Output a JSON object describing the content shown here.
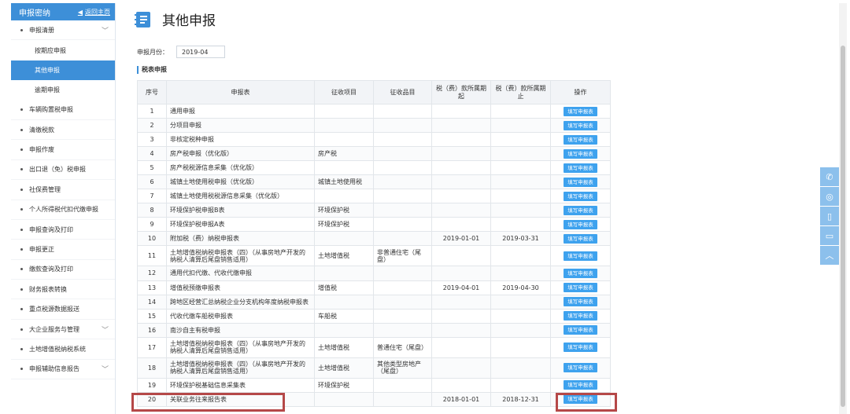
{
  "sidebar": {
    "header_title": "申报密纳",
    "back_label": "返回主页",
    "groups": [
      {
        "label": "申报清册",
        "expandable": true,
        "subs": [
          {
            "label": "按期应申报",
            "active": false
          },
          {
            "label": "其他申报",
            "active": true
          },
          {
            "label": "逾期申报",
            "active": false
          }
        ]
      },
      {
        "label": "车辆购置税申报",
        "expandable": false
      },
      {
        "label": "清缴税款",
        "expandable": false
      },
      {
        "label": "申报作废",
        "expandable": false
      },
      {
        "label": "出口退（免）税申报",
        "expandable": false
      },
      {
        "label": "社保费管理",
        "expandable": false
      },
      {
        "label": "个人所得税代扣代缴申报",
        "expandable": false
      },
      {
        "label": "申报查询及打印",
        "expandable": false
      },
      {
        "label": "申报更正",
        "expandable": false
      },
      {
        "label": "缴款查询及打印",
        "expandable": false
      },
      {
        "label": "财务报表转换",
        "expandable": false
      },
      {
        "label": "重点税源数据报送",
        "expandable": false
      },
      {
        "label": "大企业服务与管理",
        "expandable": true
      },
      {
        "label": "土地增值税纳税系统",
        "expandable": false
      },
      {
        "label": "申报辅助信息报告",
        "expandable": true
      }
    ]
  },
  "page": {
    "title": "其他申报",
    "month_label": "申报月份：",
    "month_value": "2019-04",
    "section_title": "税表申报"
  },
  "table": {
    "headers": [
      "序号",
      "申报表",
      "征收项目",
      "征收品目",
      "税（费）款所属期起",
      "税（费）款所属期止",
      "操作"
    ],
    "button_label": "填写申报表",
    "rows": [
      {
        "no": "1",
        "name": "通用申报",
        "item": "",
        "sub": "",
        "start": "",
        "end": ""
      },
      {
        "no": "2",
        "name": "分项目申报",
        "item": "",
        "sub": "",
        "start": "",
        "end": ""
      },
      {
        "no": "3",
        "name": "非核定税种申报",
        "item": "",
        "sub": "",
        "start": "",
        "end": ""
      },
      {
        "no": "4",
        "name": "房产税申报（优化版）",
        "item": "房产税",
        "sub": "",
        "start": "",
        "end": ""
      },
      {
        "no": "5",
        "name": "房产税税源信息采集（优化版）",
        "item": "",
        "sub": "",
        "start": "",
        "end": ""
      },
      {
        "no": "6",
        "name": "城镇土地使用税申报（优化版）",
        "item": "城镇土地使用税",
        "sub": "",
        "start": "",
        "end": ""
      },
      {
        "no": "7",
        "name": "城镇土地使用税税源信息采集（优化版）",
        "item": "",
        "sub": "",
        "start": "",
        "end": ""
      },
      {
        "no": "8",
        "name": "环境保护税申报B表",
        "item": "环境保护税",
        "sub": "",
        "start": "",
        "end": ""
      },
      {
        "no": "9",
        "name": "环境保护税申报A表",
        "item": "环境保护税",
        "sub": "",
        "start": "",
        "end": ""
      },
      {
        "no": "10",
        "name": "附加税（费）纳税申报表",
        "item": "",
        "sub": "",
        "start": "2019-01-01",
        "end": "2019-03-31"
      },
      {
        "no": "11",
        "name": "土地增值税纳税申报表（四）（从事房地产开发的纳税人清算后尾盘销售适用）",
        "item": "土地增值税",
        "sub": "非普通住宅（尾盘）",
        "start": "",
        "end": "",
        "tall": true
      },
      {
        "no": "12",
        "name": "通用代扣代缴、代收代缴申报",
        "item": "",
        "sub": "",
        "start": "",
        "end": ""
      },
      {
        "no": "13",
        "name": "增值税预缴申报表",
        "item": "增值税",
        "sub": "",
        "start": "2019-04-01",
        "end": "2019-04-30"
      },
      {
        "no": "14",
        "name": "跨地区经营汇总纳税企业分支机构年度纳税申报表",
        "item": "",
        "sub": "",
        "start": "",
        "end": ""
      },
      {
        "no": "15",
        "name": "代收代缴车船税申报表",
        "item": "车船税",
        "sub": "",
        "start": "",
        "end": ""
      },
      {
        "no": "16",
        "name": "南沙自主有税申报",
        "item": "",
        "sub": "",
        "start": "",
        "end": ""
      },
      {
        "no": "17",
        "name": "土地增值税纳税申报表（四）（从事房地产开发的纳税人清算后尾盘销售适用）",
        "item": "土地增值税",
        "sub": "普通住宅（尾盘）",
        "start": "",
        "end": "",
        "tall": true
      },
      {
        "no": "18",
        "name": "土地增值税纳税申报表（四）（从事房地产开发的纳税人清算后尾盘销售适用）",
        "item": "土地增值税",
        "sub": "其他类型房地产（尾盘）",
        "start": "",
        "end": "",
        "tall": true
      },
      {
        "no": "19",
        "name": "环境保护税基础信息采集表",
        "item": "环境保护税",
        "sub": "",
        "start": "",
        "end": ""
      },
      {
        "no": "20",
        "name": "关联业务往来报告表",
        "item": "",
        "sub": "",
        "start": "2018-01-01",
        "end": "2018-12-31"
      }
    ]
  },
  "side_tools": [
    {
      "icon": "wechat-icon",
      "glyph": "✆"
    },
    {
      "icon": "weibo-icon",
      "glyph": "◎"
    },
    {
      "icon": "mobile-icon",
      "glyph": "▯"
    },
    {
      "icon": "tablet-icon",
      "glyph": "▭"
    },
    {
      "icon": "back-to-top-icon",
      "glyph": "︿"
    }
  ],
  "colors": {
    "accent": "#3d8fd8",
    "button": "#3ea2ee",
    "highlight": "#b54848"
  }
}
